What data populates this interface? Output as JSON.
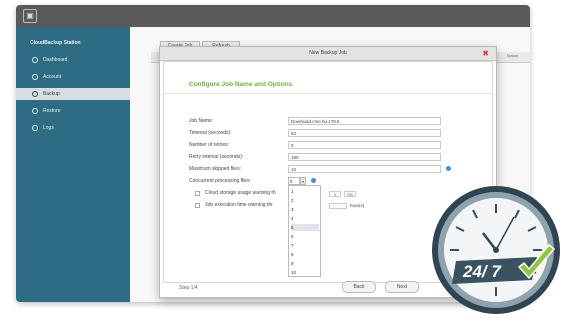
{
  "app": {
    "sidebar": {
      "title": "CloudBackup Station",
      "items": [
        {
          "label": "Dashboard",
          "icon": "dashboard-icon"
        },
        {
          "label": "Account",
          "icon": "account-icon"
        },
        {
          "label": "Backup",
          "icon": "backup-icon",
          "active": true
        },
        {
          "label": "Restore",
          "icon": "restore-icon"
        },
        {
          "label": "Logs",
          "icon": "logs-icon"
        }
      ]
    },
    "toolbar": {
      "create_label": "Create Job",
      "refresh_label": "Refresh"
    },
    "grid": {
      "right_header": "Status"
    }
  },
  "dialog": {
    "title": "New Backup Job",
    "section_title": "Configure Job Name and Options",
    "fields": [
      {
        "label": "Job Name:",
        "value": "Download.cme.bu.178.8"
      },
      {
        "label": "Timeout (seconds):",
        "value": "60"
      },
      {
        "label": "Number of retries:",
        "value": "5"
      },
      {
        "label": "Retry interval (seconds):",
        "value": "180"
      },
      {
        "label": "Maximum skipped files:",
        "value": "10"
      }
    ],
    "concurrent_label": "Concurrent processing files:",
    "concurrent_value": "5",
    "dropdown_options": [
      "1",
      "2",
      "3",
      "4",
      "5",
      "6",
      "7",
      "8",
      "9",
      "10"
    ],
    "checkboxes": [
      {
        "label": "Cloud storage usage warning th",
        "suffix": ""
      },
      {
        "label": "Job execution time warning thr",
        "suffix": "hour(s)"
      }
    ],
    "mini_fields": [
      "0",
      "GB"
    ],
    "step_label": "Step 1/4",
    "back_label": "Back",
    "next_label": "Next"
  },
  "badge": {
    "text": "24/ 7",
    "accent_color": "#8dc63f",
    "frame_color": "#39505c"
  }
}
